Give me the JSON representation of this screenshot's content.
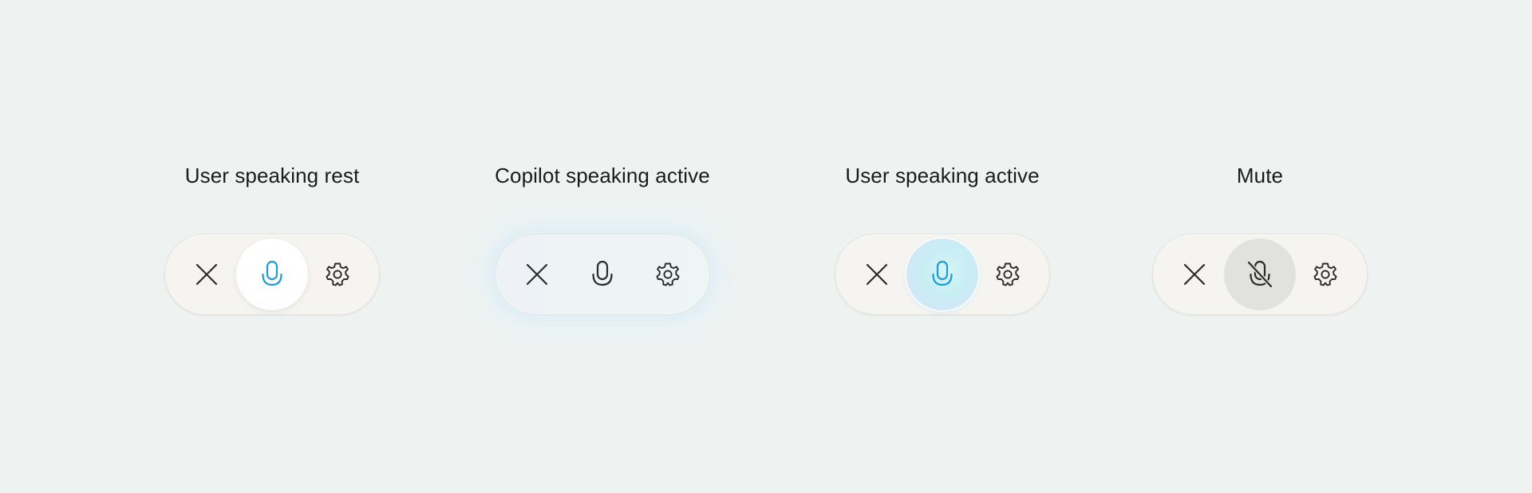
{
  "variants": [
    {
      "title": "User speaking rest",
      "close_icon": "close-icon",
      "mic_icon": "microphone-icon",
      "settings_icon": "gear-icon",
      "mic_state": "rest"
    },
    {
      "title": "Copilot speaking active",
      "close_icon": "close-icon",
      "mic_icon": "microphone-icon",
      "settings_icon": "gear-icon",
      "mic_state": "copilot-speaking"
    },
    {
      "title": "User speaking active",
      "close_icon": "close-icon",
      "mic_icon": "microphone-icon",
      "settings_icon": "gear-icon",
      "mic_state": "active"
    },
    {
      "title": "Mute",
      "close_icon": "close-icon",
      "mic_icon": "microphone-off-icon",
      "settings_icon": "gear-icon",
      "mic_state": "muted"
    }
  ],
  "colors": {
    "background": "#eef3f2",
    "pill": "#f5f4f0",
    "icon": "#2b2b2b",
    "mic_accent": "#1d9bd6",
    "muted_circle": "#e1e2de"
  }
}
